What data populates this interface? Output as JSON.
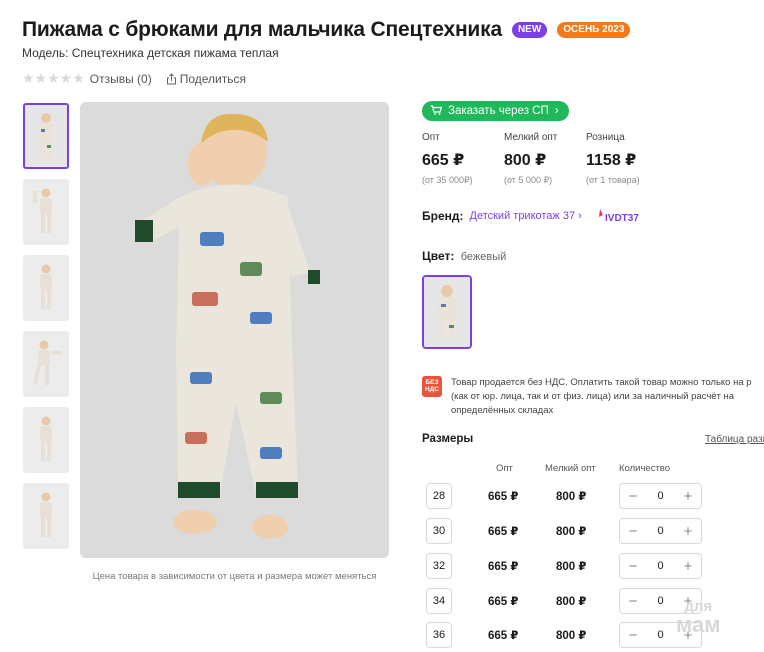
{
  "product": {
    "title": "Пижама с брюками для мальчика Спецтехника",
    "badge_new": "NEW",
    "badge_season": "ОСЕНЬ 2023",
    "model": "Модель: Спецтехника детская пижама теплая",
    "stars": "★★★★★",
    "reviews": "Отзывы (0)",
    "share": "Поделиться",
    "rating_stars": 0
  },
  "gallery": {
    "thumbnail_count": 6,
    "active_index": 0,
    "note": "Цена товара в зависимости от цвета и размера может меняться"
  },
  "order": {
    "button_label": "Заказать через СП",
    "accent_color": "#21b85c"
  },
  "prices": [
    {
      "label": "Опт",
      "value": "665 ₽",
      "sub": "(от 35 000₽)"
    },
    {
      "label": "Мелкий опт",
      "value": "800 ₽",
      "sub": "(от 5 000 ₽)"
    },
    {
      "label": "Розница",
      "value": "1158 ₽",
      "sub": "(от 1 товара)"
    }
  ],
  "brand": {
    "label": "Бренд:",
    "name": "Детский трикотаж 37",
    "logo_text": "IVDT37"
  },
  "color": {
    "label": "Цвет:",
    "value": "бежевый"
  },
  "vat": {
    "icon_text": "БЕЗ НДС",
    "text": "Товар продается без НДС. Оплатить такой товар можно только на р (как от юр. лица, так и от физ. лица) или за наличный расчёт на определённых складах"
  },
  "sizes": {
    "title": "Размеры",
    "table_link": "Таблица разм",
    "col_opt": "Опт",
    "col_small_opt": "Мелкий опт",
    "col_qty": "Количество",
    "rows": [
      {
        "size": "28",
        "opt": "665 ₽",
        "small_opt": "800 ₽",
        "qty": "0"
      },
      {
        "size": "30",
        "opt": "665 ₽",
        "small_opt": "800 ₽",
        "qty": "0"
      },
      {
        "size": "32",
        "opt": "665 ₽",
        "small_opt": "800 ₽",
        "qty": "0"
      },
      {
        "size": "34",
        "opt": "665 ₽",
        "small_opt": "800 ₽",
        "qty": "0"
      },
      {
        "size": "36",
        "opt": "665 ₽",
        "small_opt": "800 ₽",
        "qty": "0"
      }
    ],
    "minus": "−",
    "plus": "+"
  },
  "watermark": {
    "line1": "для",
    "line2": "мам"
  },
  "colors": {
    "accent": "#7b3fe4",
    "green": "#21b85c",
    "orange": "#f07a1d",
    "vat": "#e8553b"
  }
}
